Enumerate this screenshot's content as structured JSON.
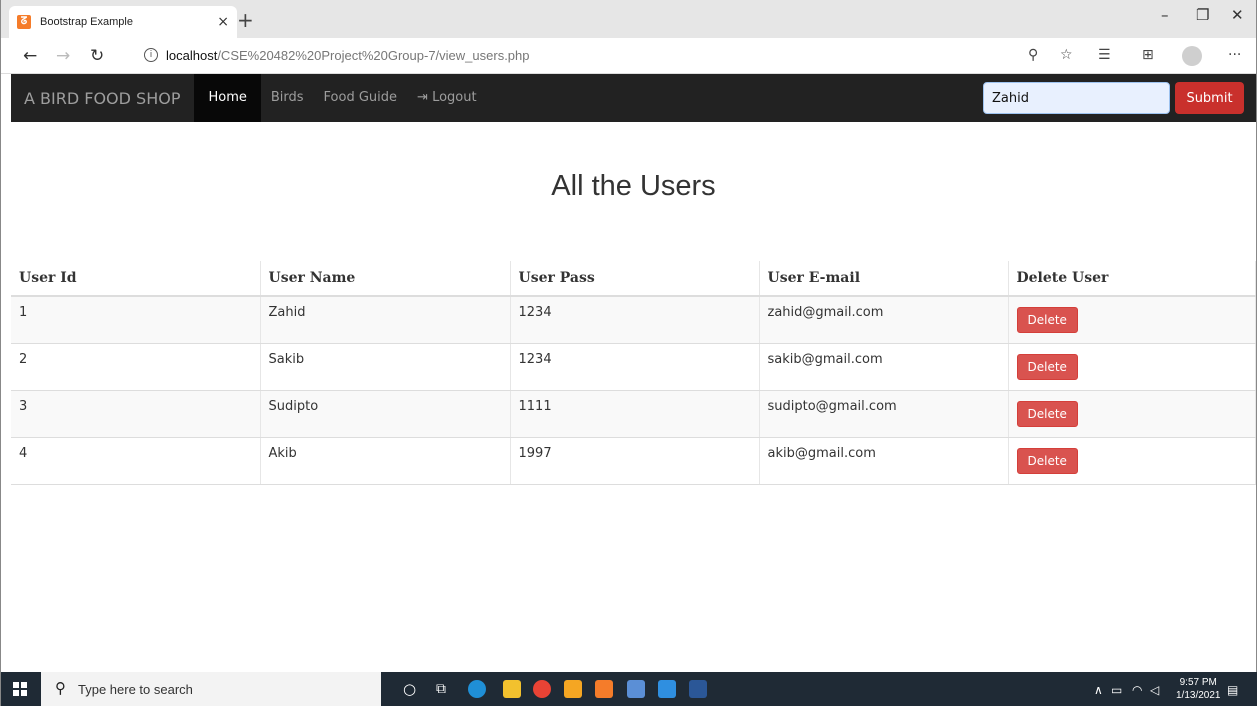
{
  "browser": {
    "tab_title": "Bootstrap Example",
    "tab_close": "×",
    "new_tab": "+",
    "url_host": "localhost",
    "url_path": "/CSE%20482%20Project%20Group-7/view_users.php"
  },
  "app_nav": {
    "brand": "A BIRD FOOD SHOP",
    "links": [
      "Home",
      "Birds",
      "Food Guide",
      "Logout"
    ],
    "active": "Home",
    "search_value": "Zahid",
    "submit_label": "Submit"
  },
  "page": {
    "title": "All the Users",
    "columns": [
      "User Id",
      "User Name",
      "User Pass",
      "User E-mail",
      "Delete User"
    ],
    "rows": [
      {
        "id": "1",
        "name": "Zahid",
        "pass": "1234",
        "email": "zahid@gmail.com"
      },
      {
        "id": "2",
        "name": "Sakib",
        "pass": "1234",
        "email": "sakib@gmail.com"
      },
      {
        "id": "3",
        "name": "Sudipto",
        "pass": "1111",
        "email": "sudipto@gmail.com"
      },
      {
        "id": "4",
        "name": "Akib",
        "pass": "1997",
        "email": "akib@gmail.com"
      }
    ],
    "delete_label": "Delete"
  },
  "taskbar": {
    "search_placeholder": "Type here to search",
    "time": "9:57 PM",
    "date": "1/13/2021"
  }
}
